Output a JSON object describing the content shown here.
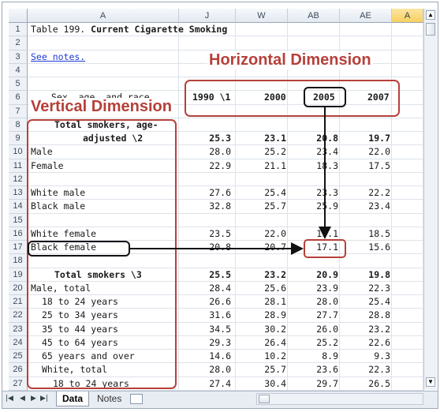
{
  "columns": [
    "A",
    "J",
    "W",
    "AB",
    "AE",
    "A"
  ],
  "rows": [
    "1",
    "2",
    "3",
    "4",
    "5",
    "6",
    "7",
    "8",
    "9",
    "10",
    "11",
    "12",
    "13",
    "14",
    "15",
    "16",
    "17",
    "18",
    "19",
    "20",
    "21",
    "22",
    "23",
    "24",
    "25",
    "26",
    "27"
  ],
  "cells": {
    "title_prefix": "Table 199. ",
    "title_bold": "Current Cigarette Smoking",
    "see_notes": "See notes.",
    "header_label": "Sex, age, and race",
    "years": [
      "1990 \\1",
      "2000",
      "2005",
      "2007"
    ],
    "r8": "Total smokers, age-",
    "r9": "adjusted \\2",
    "r9_vals": [
      "25.3",
      "23.1",
      "20.8",
      "19.7"
    ],
    "r10": "Male",
    "r10_vals": [
      "28.0",
      "25.2",
      "23.4",
      "22.0"
    ],
    "r11": "Female",
    "r11_vals": [
      "22.9",
      "21.1",
      "18.3",
      "17.5"
    ],
    "r13": "White male",
    "r13_vals": [
      "27.6",
      "25.4",
      "23.3",
      "22.2"
    ],
    "r14": "Black male",
    "r14_vals": [
      "32.8",
      "25.7",
      "25.9",
      "23.4"
    ],
    "r16": "White female",
    "r16_vals": [
      "23.5",
      "22.0",
      "19.1",
      "18.5"
    ],
    "r17": "Black female",
    "r17_vals": [
      "20.8",
      "20.7",
      "17.1",
      "15.6"
    ],
    "r19": "Total smokers \\3",
    "r19_vals": [
      "25.5",
      "23.2",
      "20.9",
      "19.8"
    ],
    "r20": "Male, total",
    "r20_vals": [
      "28.4",
      "25.6",
      "23.9",
      "22.3"
    ],
    "r21": "18 to 24 years",
    "r21_vals": [
      "26.6",
      "28.1",
      "28.0",
      "25.4"
    ],
    "r22": "25 to 34 years",
    "r22_vals": [
      "31.6",
      "28.9",
      "27.7",
      "28.8"
    ],
    "r23": "35 to 44 years",
    "r23_vals": [
      "34.5",
      "30.2",
      "26.0",
      "23.2"
    ],
    "r24": "45 to 64 years",
    "r24_vals": [
      "29.3",
      "26.4",
      "25.2",
      "22.6"
    ],
    "r25": "65 years and over",
    "r25_vals": [
      "14.6",
      "10.2",
      "8.9",
      "9.3"
    ],
    "r26": "White, total",
    "r26_vals": [
      "28.0",
      "25.7",
      "23.6",
      "22.3"
    ],
    "r27": "18 to 24 years",
    "r27_vals": [
      "27.4",
      "30.4",
      "29.7",
      "26.5"
    ]
  },
  "annotations": {
    "horizontal": "Horizontal Dimension",
    "vertical": "Vertical Dimension"
  },
  "sheets": [
    "Data",
    "Notes"
  ],
  "colors": {
    "annotation_red": "#b5403a",
    "link_blue": "#1f3bd8"
  }
}
